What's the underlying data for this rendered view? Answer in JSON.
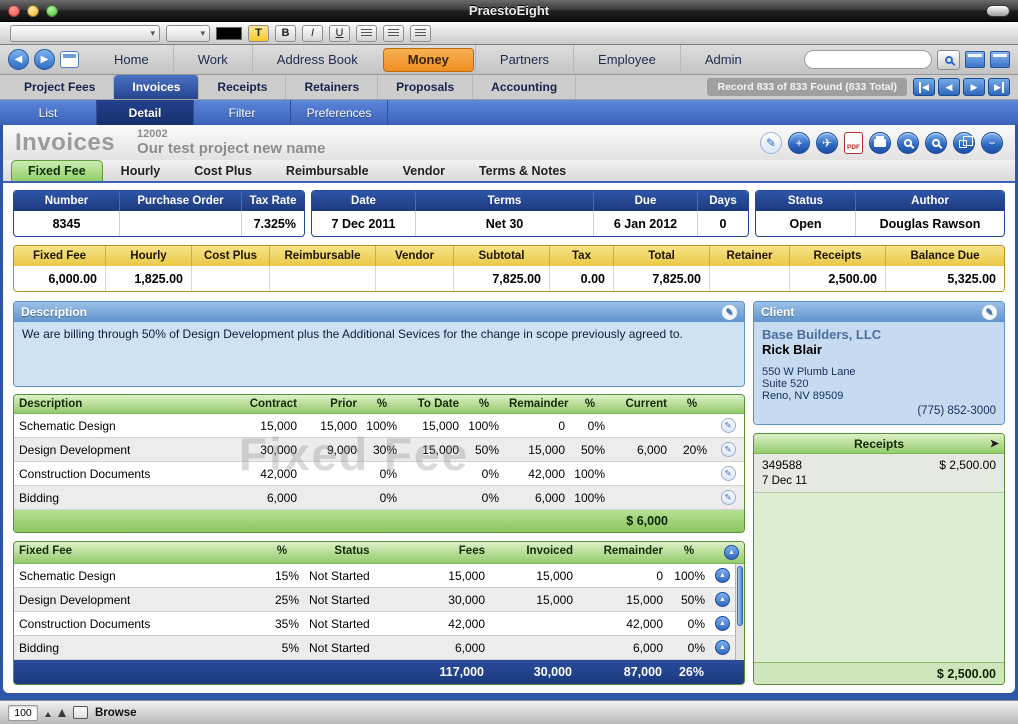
{
  "window": {
    "title": "PraestoEight"
  },
  "formatbar": {
    "bold": "B",
    "italic": "I",
    "underline": "U",
    "text_tool": "T"
  },
  "icons": {
    "back": "◀",
    "forward": "▶",
    "edit": "✎",
    "add": "+",
    "send": "✈",
    "pdf": "PDF",
    "omit": "−",
    "up": "▲",
    "first": "◀",
    "prev": "◀",
    "next": "▶",
    "last": "▶",
    "chevron": "▾",
    "receipts_action": "➤"
  },
  "colors": {
    "accent_blue": "#2e55a8",
    "active_tab_orange": "#ef8d1f",
    "table_green": "#94cb6b",
    "band_yellow": "#e9c845",
    "navy_header": "#1d3a7e"
  },
  "nav": {
    "tabs": [
      "Home",
      "Work",
      "Address Book",
      "Money",
      "Partners",
      "Employee",
      "Admin"
    ],
    "active_tab": "Money",
    "search_value": ""
  },
  "subnav": {
    "tabs": [
      "Project Fees",
      "Invoices",
      "Receipts",
      "Retainers",
      "Proposals",
      "Accounting"
    ],
    "active_tab": "Invoices",
    "record_status": "Record 833 of 833 Found (833 Total)"
  },
  "viewnav": {
    "tabs": [
      "List",
      "Detail",
      "Filter",
      "Preferences"
    ],
    "active_tab": "Detail"
  },
  "header": {
    "title": "Invoices",
    "invoice_number": "12002",
    "project_name": "Our test project new name"
  },
  "fee_tabs": [
    "Fixed Fee",
    "Hourly",
    "Cost Plus",
    "Reimbursable",
    "Vendor",
    "Terms & Notes"
  ],
  "fee_tabs_active": "Fixed Fee",
  "invoice_info": {
    "labels": {
      "number": "Number",
      "po": "Purchase Order",
      "tax_rate": "Tax Rate",
      "date": "Date",
      "terms": "Terms",
      "due": "Due",
      "days": "Days",
      "status": "Status",
      "author": "Author"
    },
    "values": {
      "number": "8345",
      "po": "",
      "tax_rate": "7.325%",
      "date": "7 Dec 2011",
      "terms": "Net 30",
      "due": "6 Jan 2012",
      "days": "0",
      "status": "Open",
      "author": "Douglas Rawson"
    }
  },
  "fee_summary": {
    "headers": [
      "Fixed Fee",
      "Hourly",
      "Cost Plus",
      "Reimbursable",
      "Vendor",
      "Subtotal",
      "Tax",
      "Total",
      "Retainer",
      "Receipts",
      "Balance Due"
    ],
    "values": [
      "6,000.00",
      "1,825.00",
      "",
      "",
      "",
      "7,825.00",
      "0.00",
      "7,825.00",
      "",
      "2,500.00",
      "5,325.00"
    ]
  },
  "description_panel": {
    "title": "Description",
    "text": "We are billing through 50% of Design Development plus the Additional Sevices for the change in scope previously agreed to."
  },
  "client_panel": {
    "title": "Client",
    "company": "Base Builders, LLC",
    "contact": "Rick Blair",
    "address_line1": "550 W Plumb Lane",
    "address_line2": "Suite 520",
    "address_line3": "Reno, NV 89509",
    "phone": "(775) 852-3000"
  },
  "phases_table": {
    "headers": [
      "Description",
      "Contract",
      "Prior",
      "%",
      "To Date",
      "%",
      "Remainder",
      "%",
      "Current",
      "%"
    ],
    "rows": [
      [
        "Schematic Design",
        "15,000",
        "15,000",
        "100%",
        "15,000",
        "100%",
        "0",
        "0%",
        "",
        ""
      ],
      [
        "Design Development",
        "30,000",
        "9,000",
        "30%",
        "15,000",
        "50%",
        "15,000",
        "50%",
        "6,000",
        "20%"
      ],
      [
        "Construction Documents",
        "42,000",
        "",
        "0%",
        "",
        "0%",
        "42,000",
        "100%",
        "",
        ""
      ],
      [
        "Bidding",
        "6,000",
        "",
        "0%",
        "",
        "0%",
        "6,000",
        "100%",
        "",
        ""
      ]
    ],
    "total_label": "$ 6,000",
    "watermark": "Fixed Fee"
  },
  "fixed_fee_table": {
    "headers": [
      "Fixed Fee",
      "%",
      "Status",
      "Fees",
      "Invoiced",
      "Remainder",
      "%"
    ],
    "rows": [
      [
        "Schematic Design",
        "15%",
        "Not Started",
        "15,000",
        "15,000",
        "0",
        "100%"
      ],
      [
        "Design Development",
        "25%",
        "Not Started",
        "30,000",
        "15,000",
        "15,000",
        "50%"
      ],
      [
        "Construction Documents",
        "35%",
        "Not Started",
        "42,000",
        "",
        "42,000",
        "0%"
      ],
      [
        "Bidding",
        "5%",
        "Not Started",
        "6,000",
        "",
        "6,000",
        "0%"
      ]
    ],
    "totals": [
      "117,000",
      "30,000",
      "87,000",
      "26%"
    ]
  },
  "receipts_panel": {
    "title": "Receipts",
    "entries": [
      {
        "number": "349588",
        "amount": "$ 2,500.00",
        "date": "7 Dec 11"
      }
    ],
    "total": "$ 2,500.00"
  },
  "statusbar": {
    "zoom": "100",
    "mode": "Browse"
  }
}
